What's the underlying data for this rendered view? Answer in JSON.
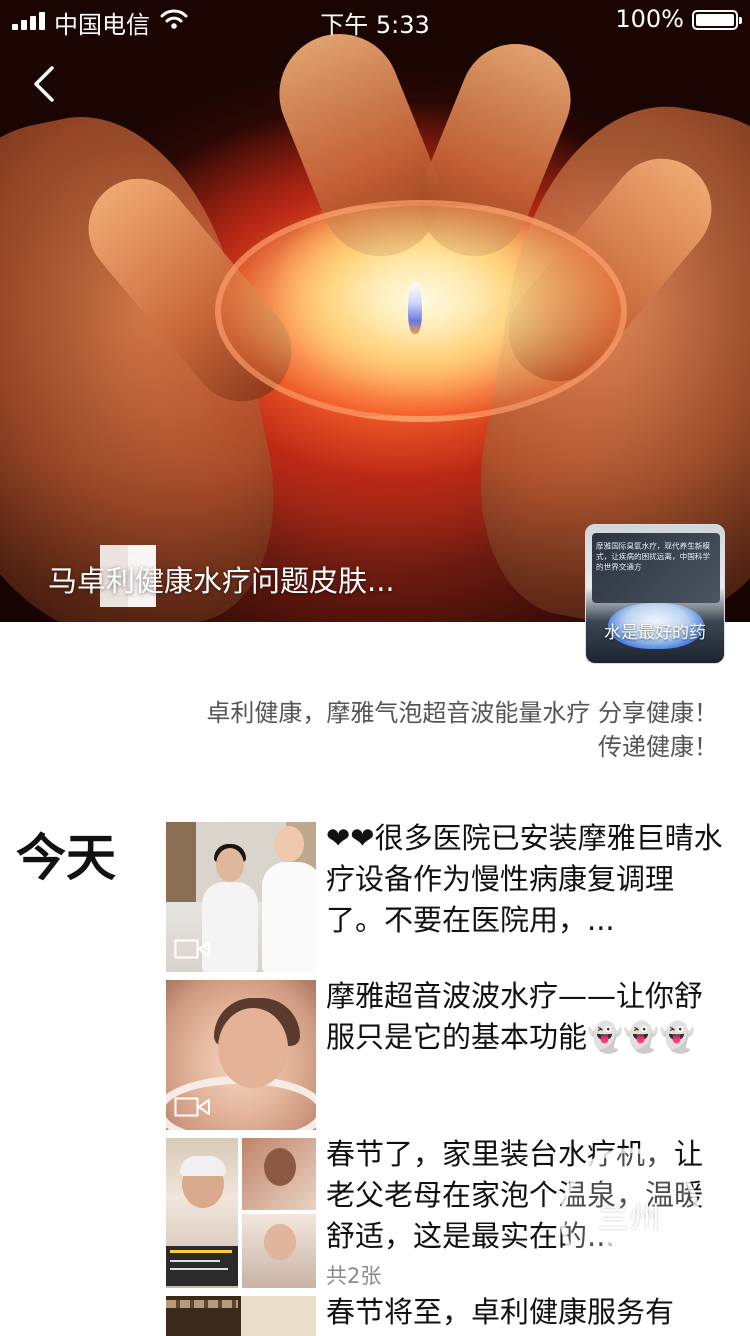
{
  "status_bar": {
    "carrier": "中国电信",
    "time": "下午 5:33",
    "battery": "100%"
  },
  "cover": {
    "title": "马卓利健康水疗问题皮肤...",
    "avatar_slogan": "水是最好的药",
    "avatar_caption": "摩雅国际臭氧水疗，现代养生新模式，让疾病的困扰远离，中国科学的世界交通方"
  },
  "signature": {
    "line1": "卓利健康，摩雅气泡超音波能量水疗 分享健康！",
    "line2": "传递健康！"
  },
  "timeline": {
    "day_label": "今天",
    "posts": [
      {
        "text": "❤❤很多医院已安装摩雅巨晴水疗设备作为慢性病康复调理了。不要在医院用，...",
        "type": "video"
      },
      {
        "text": "摩雅超音波波水疗——让你舒服只是它的基本功能👻👻👻",
        "type": "video"
      },
      {
        "text": "春节了，家里装台水疗机，让老父老母在家泡个温泉，温暖舒适，这是最实在的...",
        "image_count": "共2张"
      },
      {
        "text": "春节将至，卓利健康服务有"
      }
    ]
  },
  "watermark": {
    "title": "兰州",
    "subtitle": "看 新 闻"
  },
  "icons": {
    "back": "chevron-left-icon",
    "video": "video-camera-icon",
    "wifi": "wifi-icon",
    "battery": "battery-icon",
    "signal": "cellular-signal-icon"
  }
}
